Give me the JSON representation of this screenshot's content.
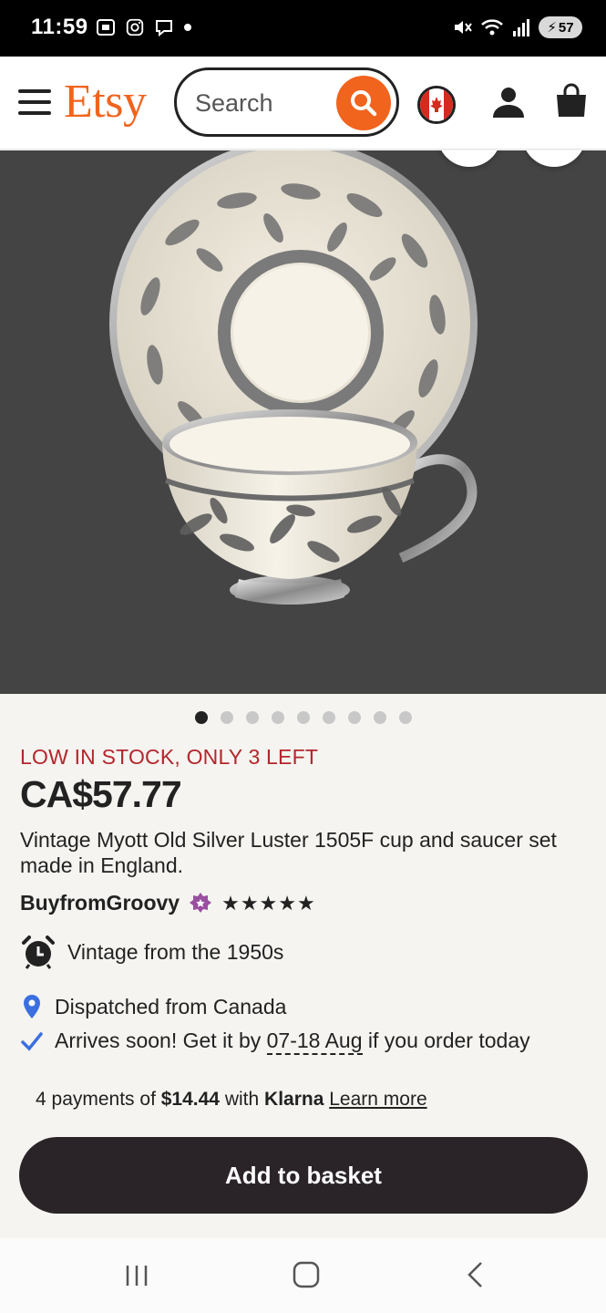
{
  "status_bar": {
    "time": "11:59",
    "battery": "57"
  },
  "header": {
    "logo": "Etsy",
    "search_placeholder": "Search"
  },
  "product": {
    "image_count": 9,
    "active_image": 1,
    "stock_notice": "LOW IN STOCK, ONLY 3 LEFT",
    "price": "CA$57.77",
    "title": "Vintage Myott Old Silver Luster 1505F cup and saucer set made in England.",
    "shop_name": "BuyfromGroovy",
    "rating_stars": "★★★★★",
    "vintage": "Vintage from the 1950s",
    "dispatch": "Dispatched from Canada",
    "arrival_prefix": "Arrives soon! Get it by",
    "arrival_dates": "07-18 Aug",
    "arrival_suffix": "if you order today"
  },
  "klarna": {
    "prefix": "4 payments of",
    "amount": "$14.44",
    "with": "with",
    "brand": "Klarna",
    "link": "Learn more"
  },
  "actions": {
    "add_to_basket": "Add to basket"
  },
  "colors": {
    "brand": "#f1641e",
    "stock_red": "#b3262d",
    "button_dark": "#2a2328",
    "star_seller_purple": "#9a4fa0",
    "location_blue": "#3b6fe0"
  }
}
